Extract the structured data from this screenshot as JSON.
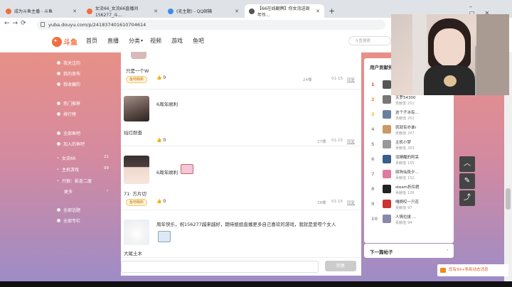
{
  "browser": {
    "tabs": [
      {
        "label": "成为斗鱼主播 - 斗鱼"
      },
      {
        "label": "女流66_女流66直播间156277_斗..."
      },
      {
        "label": "(无主题) - QQ邮箱"
      },
      {
        "label": "【66在线翻牌】你女流送周年作..."
      }
    ],
    "new_tab": "+",
    "url": "yuba.douyu.com/p/241837401610704614"
  },
  "nav": {
    "logo": "斗鱼",
    "items": [
      "首页",
      "直播",
      "分类",
      "视频",
      "游戏",
      "鱼吧"
    ],
    "category_arrow": "▾",
    "search_placeholder": "斗鱼搜索"
  },
  "sidebar": {
    "group1": [
      "我关注的",
      "我的发布",
      "我收藏的"
    ],
    "group2": [
      "热门推荐",
      "排行榜"
    ],
    "group3": [
      "全部鱼吧",
      "加入的鱼吧"
    ],
    "bars": [
      {
        "name": "女流66",
        "count": "21"
      },
      {
        "name": "主机游戏",
        "count": "99"
      },
      {
        "name": "只狼：影逝二度",
        "count": ""
      }
    ],
    "more": "更多",
    "group4": [
      "全部话题",
      "全部专栏"
    ]
  },
  "posts": [
    {
      "name": "只是一个W",
      "badge": "鱼吧萌新",
      "likes": "0",
      "floor": "24楼",
      "time": "01-15",
      "reply": "回复",
      "text": ""
    },
    {
      "name": "灿烂耐查",
      "badge": "",
      "likes": "0",
      "floor": "27楼",
      "time": "01-15",
      "reply": "回复",
      "text": "6周年顺利"
    },
    {
      "name": "71· 方片切",
      "badge": "鱼吧萌新",
      "likes": "0",
      "floor": "28楼",
      "time": "01-15",
      "reply": "回复",
      "text": "6周年顺利"
    },
    {
      "name": "大尾土木",
      "badge": "",
      "likes": "",
      "floor": "",
      "time": "",
      "reply": "",
      "text": "周年快乐，祝156277越来越好，期待姐姐直播更多自己喜欢的游戏，我就是爱唠个女人"
    }
  ],
  "reply_bar": {
    "button": "回复"
  },
  "contributors": {
    "title": "用户贡献排行",
    "more": "›",
    "value_label": "贡献值",
    "list": [
      {
        "rank": "1",
        "name": "",
        "value": ""
      },
      {
        "rank": "2",
        "name": "天罗54300",
        "value": "251"
      },
      {
        "rank": "3",
        "name": "这个子冰有...",
        "value": "251"
      },
      {
        "rank": "4",
        "name": "就就有亦谁i",
        "value": "207"
      },
      {
        "rank": "5",
        "name": "主机小梦",
        "value": "203"
      },
      {
        "rank": "6",
        "name": "没睡醒的阿呆",
        "value": "155"
      },
      {
        "rank": "7",
        "name": "原狗仙段夕...",
        "value": "152"
      },
      {
        "rank": "8",
        "name": "steam折扣君",
        "value": "126"
      },
      {
        "rank": "9",
        "name": "嘎啊哎一只花",
        "value": "97"
      },
      {
        "rank": "10",
        "name": "人情拉拔 ...",
        "value": "94"
      }
    ],
    "rank_colors": [
      "#e8412c",
      "#f08a1c",
      "#f4b52a"
    ]
  },
  "next_post": {
    "label": "下一篇帖子",
    "arrow": "›"
  },
  "float_buttons": [
    "︿",
    "✎",
    "⤴"
  ],
  "toast": {
    "text": "您有99+条新动态消息"
  }
}
